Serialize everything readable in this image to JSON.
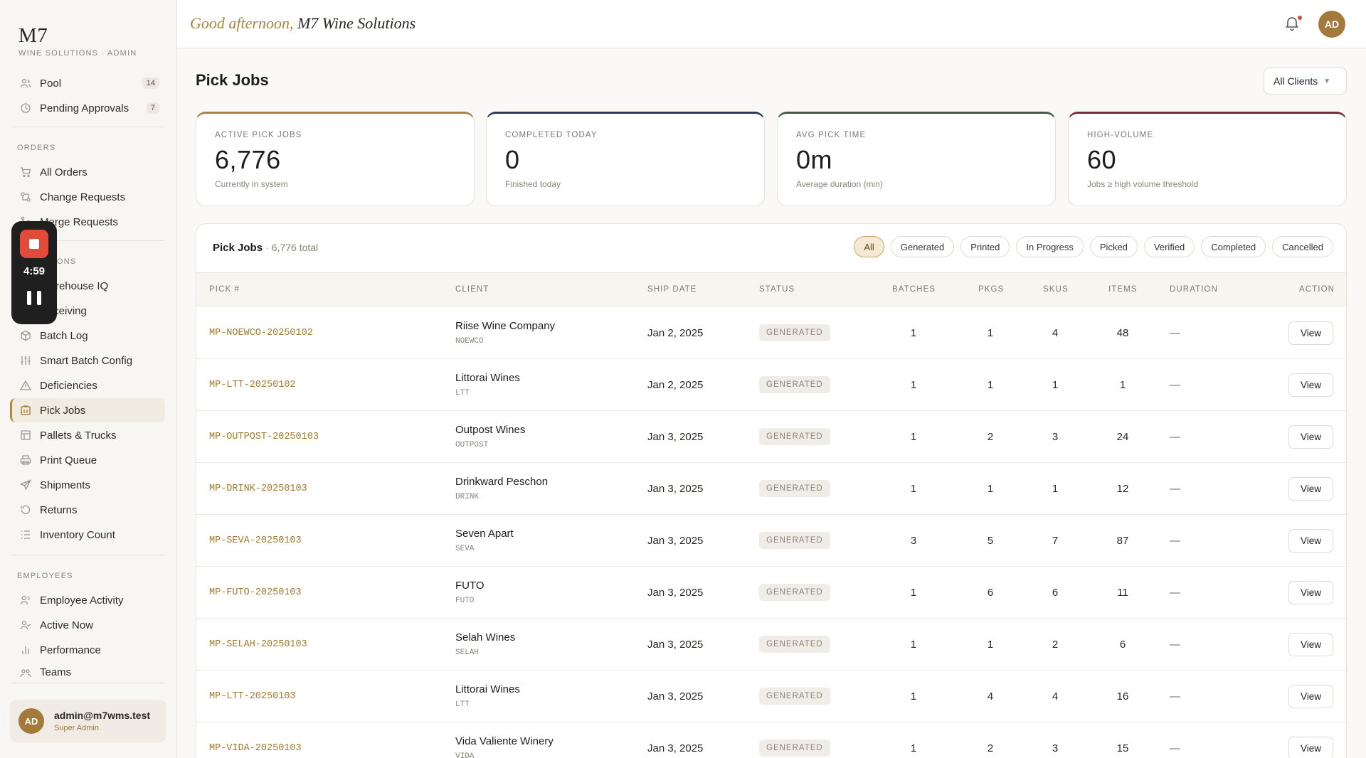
{
  "brand": {
    "logo": "M7",
    "subtitle": "WINE SOLUTIONS · ADMIN"
  },
  "sidebar": {
    "top_items": [
      {
        "label": "Pool",
        "badge": "14",
        "icon": "inbox-icon"
      },
      {
        "label": "Pending Approvals",
        "badge": "7",
        "icon": "clock-icon"
      }
    ],
    "sections": {
      "orders": "ORDERS",
      "operations": "OPERATIONS",
      "employees": "EMPLOYEES"
    },
    "orders_items": [
      {
        "label": "All Orders",
        "icon": "cart-icon"
      },
      {
        "label": "Change Requests",
        "icon": "swap-icon"
      },
      {
        "label": "Merge Requests",
        "icon": "merge-icon"
      }
    ],
    "operations_items": [
      {
        "label": "Warehouse IQ",
        "icon": "warehouse-icon"
      },
      {
        "label": "Receiving",
        "icon": "download-icon"
      },
      {
        "label": "Batch Log",
        "icon": "box-icon"
      },
      {
        "label": "Smart Batch Config",
        "icon": "sliders-icon"
      },
      {
        "label": "Deficiencies",
        "icon": "warning-icon"
      },
      {
        "label": "Pick Jobs",
        "icon": "clipboard-icon",
        "active": true
      },
      {
        "label": "Pallets & Trucks",
        "icon": "pallet-icon"
      },
      {
        "label": "Print Queue",
        "icon": "printer-icon"
      },
      {
        "label": "Shipments",
        "icon": "send-icon"
      },
      {
        "label": "Returns",
        "icon": "return-icon"
      },
      {
        "label": "Inventory Count",
        "icon": "list-icon"
      }
    ],
    "employee_items": [
      {
        "label": "Employee Activity",
        "icon": "users-icon"
      },
      {
        "label": "Active Now",
        "icon": "user-check-icon"
      },
      {
        "label": "Performance",
        "icon": "bar-chart-icon"
      },
      {
        "label": "Teams",
        "icon": "team-icon"
      }
    ],
    "user": {
      "initials": "AD",
      "email": "admin@m7wms.test",
      "role": "Super Admin"
    }
  },
  "recorder": {
    "time": "4:59"
  },
  "header": {
    "greeting": "Good afternoon,",
    "company": "M7 Wine Solutions",
    "avatar_initials": "AD"
  },
  "page": {
    "title": "Pick Jobs",
    "client_filter": "All Clients"
  },
  "stats": [
    {
      "label": "ACTIVE PICK JOBS",
      "value": "6,776",
      "sub": "Currently in system",
      "accent": "#a8843e"
    },
    {
      "label": "COMPLETED TODAY",
      "value": "0",
      "sub": "Finished today",
      "accent": "#2a3a5e"
    },
    {
      "label": "AVG PICK TIME",
      "value": "0m",
      "sub": "Average duration (min)",
      "accent": "#3f5a45"
    },
    {
      "label": "HIGH-VOLUME",
      "value": "60",
      "sub": "Jobs ≥ high volume threshold",
      "accent": "#7a2a30"
    }
  ],
  "table": {
    "title": "Pick Jobs",
    "total": "· 6,776 total",
    "filters": [
      "All",
      "Generated",
      "Printed",
      "In Progress",
      "Picked",
      "Verified",
      "Completed",
      "Cancelled"
    ],
    "active_filter": "All",
    "columns": [
      "PICK #",
      "CLIENT",
      "SHIP DATE",
      "STATUS",
      "BATCHES",
      "PKGS",
      "SKUS",
      "ITEMS",
      "DURATION",
      "ACTION"
    ],
    "rows": [
      {
        "pick": "MP-NOEWCO-20250102",
        "client": "Riise Wine Company",
        "code": "NOEWCO",
        "ship": "Jan 2, 2025",
        "status": "GENERATED",
        "batches": "1",
        "pkgs": "1",
        "skus": "4",
        "items": "48",
        "duration": "—",
        "action": "View"
      },
      {
        "pick": "MP-LTT-20250102",
        "client": "Littorai Wines",
        "code": "LTT",
        "ship": "Jan 2, 2025",
        "status": "GENERATED",
        "batches": "1",
        "pkgs": "1",
        "skus": "1",
        "items": "1",
        "duration": "—",
        "action": "View"
      },
      {
        "pick": "MP-OUTPOST-20250103",
        "client": "Outpost Wines",
        "code": "OUTPOST",
        "ship": "Jan 3, 2025",
        "status": "GENERATED",
        "batches": "1",
        "pkgs": "2",
        "skus": "3",
        "items": "24",
        "duration": "—",
        "action": "View"
      },
      {
        "pick": "MP-DRINK-20250103",
        "client": "Drinkward Peschon",
        "code": "DRINK",
        "ship": "Jan 3, 2025",
        "status": "GENERATED",
        "batches": "1",
        "pkgs": "1",
        "skus": "1",
        "items": "12",
        "duration": "—",
        "action": "View"
      },
      {
        "pick": "MP-SEVA-20250103",
        "client": "Seven Apart",
        "code": "SEVA",
        "ship": "Jan 3, 2025",
        "status": "GENERATED",
        "batches": "3",
        "pkgs": "5",
        "skus": "7",
        "items": "87",
        "duration": "—",
        "action": "View"
      },
      {
        "pick": "MP-FUTO-20250103",
        "client": "FUTO",
        "code": "FUTO",
        "ship": "Jan 3, 2025",
        "status": "GENERATED",
        "batches": "1",
        "pkgs": "6",
        "skus": "6",
        "items": "11",
        "duration": "—",
        "action": "View"
      },
      {
        "pick": "MP-SELAH-20250103",
        "client": "Selah Wines",
        "code": "SELAH",
        "ship": "Jan 3, 2025",
        "status": "GENERATED",
        "batches": "1",
        "pkgs": "1",
        "skus": "2",
        "items": "6",
        "duration": "—",
        "action": "View"
      },
      {
        "pick": "MP-LTT-20250103",
        "client": "Littorai Wines",
        "code": "LTT",
        "ship": "Jan 3, 2025",
        "status": "GENERATED",
        "batches": "1",
        "pkgs": "4",
        "skus": "4",
        "items": "16",
        "duration": "—",
        "action": "View"
      },
      {
        "pick": "MP-VIDA-20250103",
        "client": "Vida Valiente Winery",
        "code": "VIDA",
        "ship": "Jan 3, 2025",
        "status": "GENERATED",
        "batches": "1",
        "pkgs": "2",
        "skus": "3",
        "items": "15",
        "duration": "—",
        "action": "View"
      }
    ]
  }
}
